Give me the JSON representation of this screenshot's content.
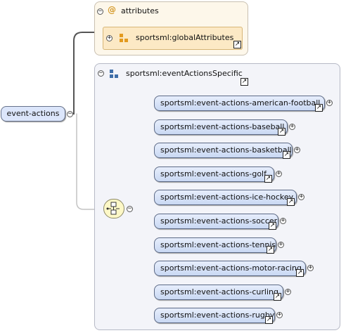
{
  "root": {
    "label": "event-actions"
  },
  "attributes_group": {
    "title": "attributes",
    "icon": "at-sign-icon",
    "ref": {
      "label": "sportsml:globalAttributes"
    }
  },
  "sequence_group": {
    "title": "sportsml:eventActionsSpecific",
    "icon": "group-icon",
    "compositor": "sequence-icon"
  },
  "elements": [
    {
      "label": "sportsml:event-actions-american-football"
    },
    {
      "label": "sportsml:event-actions-baseball"
    },
    {
      "label": "sportsml:event-actions-basketball"
    },
    {
      "label": "sportsml:event-actions-golf"
    },
    {
      "label": "sportsml:event-actions-ice-hockey"
    },
    {
      "label": "sportsml:event-actions-soccer"
    },
    {
      "label": "sportsml:event-actions-tennis"
    },
    {
      "label": "sportsml:event-actions-motor-racing"
    },
    {
      "label": "sportsml:event-actions-curling"
    },
    {
      "label": "sportsml:event-actions-rugby"
    }
  ],
  "colors": {
    "element_fill": "#c9d8f3",
    "attribute_fill": "#fce9c5",
    "compositor_fill": "#fdf8c7",
    "accent_orange": "#d59a2a"
  }
}
